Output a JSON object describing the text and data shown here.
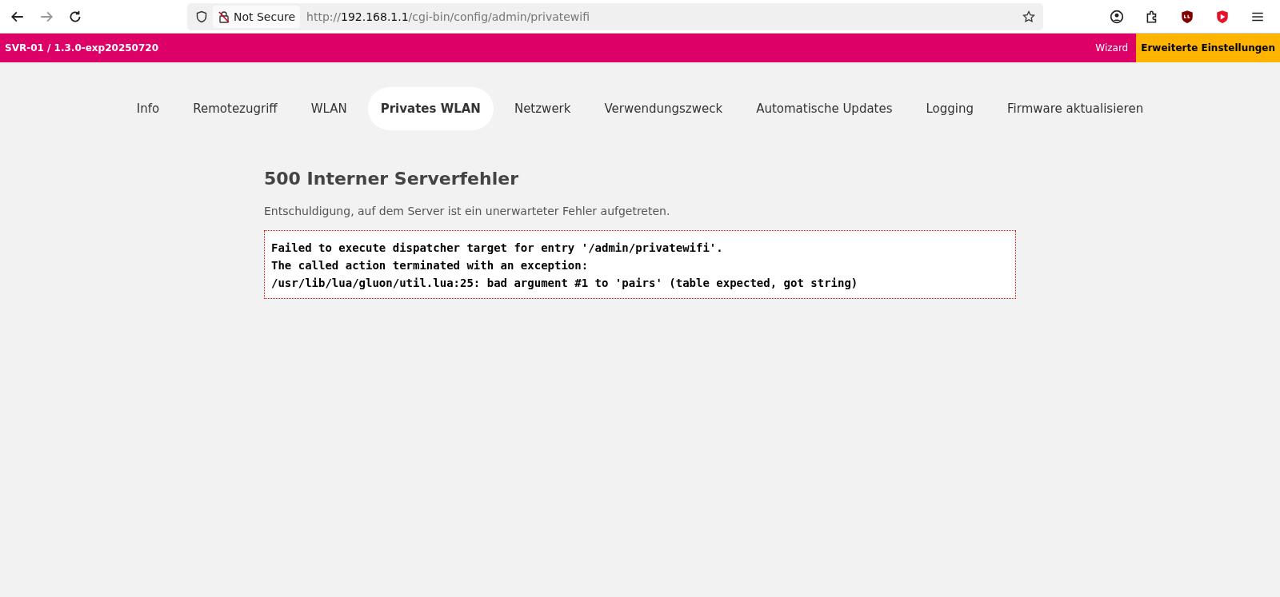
{
  "browser": {
    "security_label": "Not Secure",
    "url": {
      "scheme": "http://",
      "host": "192.168.1.1",
      "path": "/cgi-bin/config/admin/privatewifi"
    }
  },
  "header": {
    "title": "SVR-01 / 1.3.0-exp20250720",
    "links": [
      {
        "label": "Wizard",
        "selected": false
      },
      {
        "label": "Erweiterte Einstellungen",
        "selected": true
      }
    ]
  },
  "tabs": [
    {
      "label": "Info",
      "selected": false
    },
    {
      "label": "Remotezugriff",
      "selected": false
    },
    {
      "label": "WLAN",
      "selected": false
    },
    {
      "label": "Privates WLAN",
      "selected": true
    },
    {
      "label": "Netzwerk",
      "selected": false
    },
    {
      "label": "Verwendungszweck",
      "selected": false
    },
    {
      "label": "Automatische Updates",
      "selected": false
    },
    {
      "label": "Logging",
      "selected": false
    },
    {
      "label": "Firmware aktualisieren",
      "selected": false
    }
  ],
  "error": {
    "title": "500 Interner Serverfehler",
    "message": "Entschuldigung, auf dem Server ist ein unerwarteter Fehler aufgetreten.",
    "details": [
      "Failed to execute dispatcher target for entry '/admin/privatewifi'.",
      "The called action terminated with an exception:",
      "/usr/lib/lua/gluon/util.lua:25: bad argument #1 to 'pairs' (table expected, got string)"
    ]
  }
}
